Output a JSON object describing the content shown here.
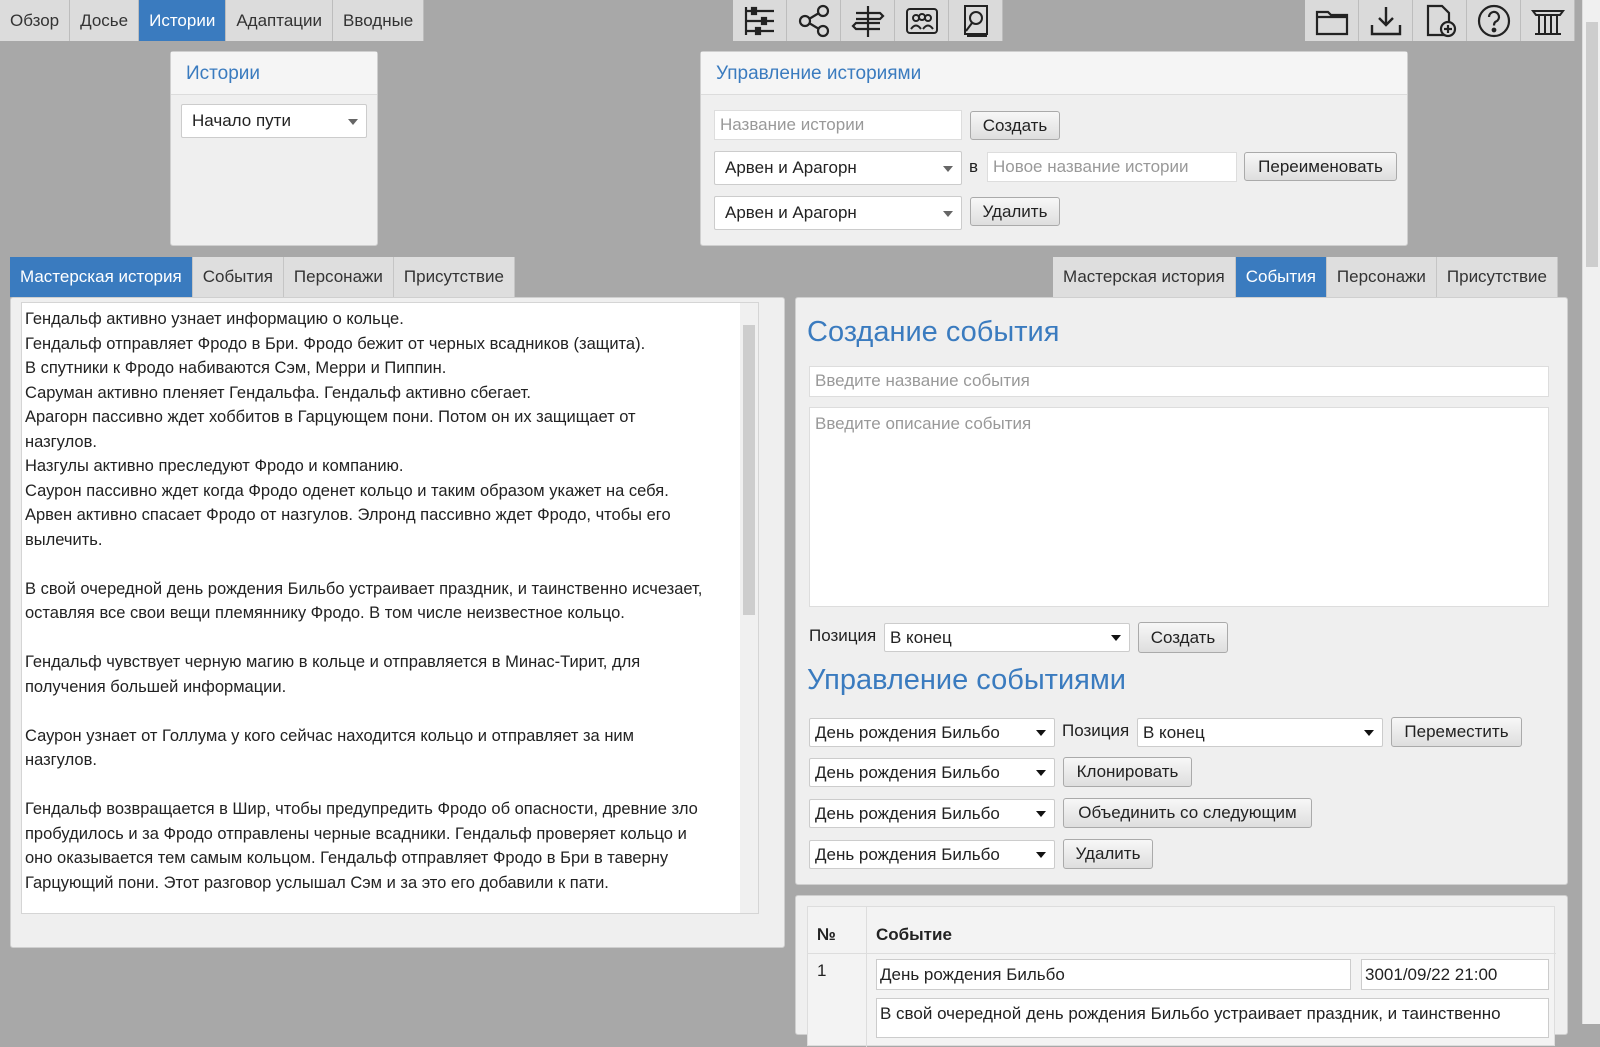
{
  "top_nav": {
    "tabs": [
      {
        "label": "Обзор",
        "active": false
      },
      {
        "label": "Досье",
        "active": false
      },
      {
        "label": "Истории",
        "active": true
      },
      {
        "label": "Адаптации",
        "active": false
      },
      {
        "label": "Вводные",
        "active": false
      }
    ]
  },
  "toolbar_center": [
    "timeline-icon",
    "share-icon",
    "signpost-icon",
    "group-icon",
    "search-doc-icon"
  ],
  "toolbar_right": [
    "folder-icon",
    "download-icon",
    "new-file-icon",
    "help-icon",
    "columns-icon"
  ],
  "stories_panel": {
    "title": "Истории",
    "selected": "Начало пути"
  },
  "manage_panel": {
    "title": "Управление историями",
    "name_placeholder": "Название истории",
    "create_label": "Создать",
    "rename_select": "Арвен и Арагорн",
    "in_label": "в",
    "new_name_placeholder": "Новое название истории",
    "rename_label": "Переименовать",
    "delete_select": "Арвен и Арагорн",
    "delete_label": "Удалить"
  },
  "left_tabs": [
    {
      "label": "Мастерская история",
      "active": true
    },
    {
      "label": "События",
      "active": false
    },
    {
      "label": "Персонажи",
      "active": false
    },
    {
      "label": "Присутствие",
      "active": false
    }
  ],
  "right_tabs": [
    {
      "label": "Мастерская история",
      "active": false
    },
    {
      "label": "События",
      "active": true
    },
    {
      "label": "Персонажи",
      "active": false
    },
    {
      "label": "Присутствие",
      "active": false
    }
  ],
  "master_story_text": "Гендальф активно узнает информацию о кольце.\nГендальф отправляет Фродо в Бри. Фродо бежит от черных всадников (защита).\nВ спутники к Фродо набиваются Сэм, Мерри и Пиппин.\nСаруман активно пленяет Гендальфа. Гендальф активно сбегает.\nАрагорн пассивно ждет хоббитов в Гарцующем пони. Потом он их защищает от\nназгулов.\nНазгулы активно преследуют Фродо и компанию.\nСаурон пассивно ждет когда Фродо оденет кольцо и таким образом укажет на себя.\nАрвен активно спасает Фродо от назгулов. Элронд пассивно ждет Фродо, чтобы его\nвылечить.\n\nВ свой очередной день рождения Бильбо устраивает праздник, и таинственно исчезает,\nоставляя все свои вещи племяннику Фродо. В том числе неизвестное кольцо.\n\nГендальф чувствует черную магию в кольце и отправляется в Минас-Тирит, для\nполучения большей информации.\n\nСаурон узнает от Голлума у кого сейчас находится кольцо и отправляет за ним\nназгулов.\n\nГендальф возвращается в Шир, чтобы предупредить Фродо об опасности, древние зло\nпробудилось и за Фродо отправлены черные всадники. Гендальф проверяет кольцо и\nоно оказывается тем самым кольцом. Гендальф отправляет Фродо в Бри в таверну\nГарцующий пони. Этот разговор услышал Сэм и за это его добавили к пати.",
  "create_event": {
    "title": "Создание события",
    "name_placeholder": "Введите название события",
    "desc_placeholder": "Введите описание события",
    "position_label": "Позиция",
    "position_value": "В конец",
    "create_label": "Создать"
  },
  "manage_events": {
    "title": "Управление событиями",
    "move_select": "День рождения Бильбо",
    "position_label": "Позиция",
    "position_value": "В конец",
    "move_label": "Переместить",
    "clone_select": "День рождения Бильбо",
    "clone_label": "Клонировать",
    "merge_select": "День рождения Бильбо",
    "merge_label": "Объединить со следующим",
    "delete_select": "День рождения Бильбо",
    "delete_label": "Удалить"
  },
  "events_table": {
    "headers": [
      "№",
      "Событие"
    ],
    "rows": [
      {
        "num": "1",
        "name": "День рождения Бильбо",
        "time": "3001/09/22 21:00",
        "desc": "В свой очередной день рождения Бильбо устраивает праздник, и таинственно"
      }
    ]
  }
}
